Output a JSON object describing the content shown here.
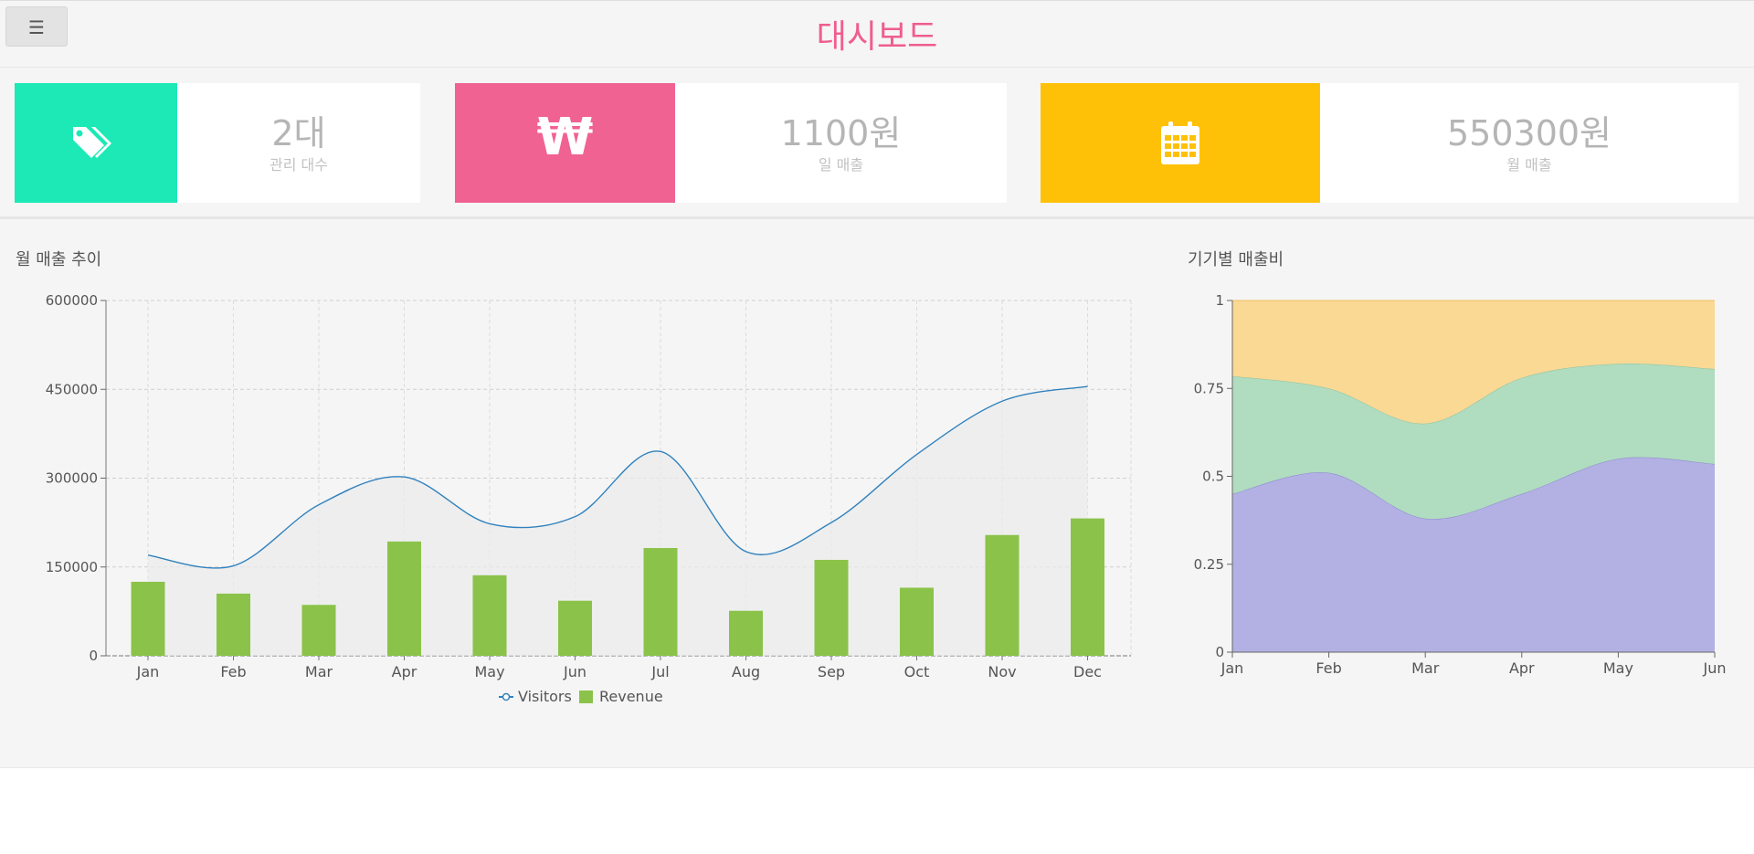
{
  "header": {
    "title": "대시보드",
    "menu_icon": "☰"
  },
  "stats": [
    {
      "icon": "tags-icon",
      "value": "2대",
      "label": "관리 대수",
      "color": "#1de9b6"
    },
    {
      "icon": "won-icon",
      "value": "1100원",
      "label": "일 매출",
      "color": "#f06292",
      "glyph": "₩"
    },
    {
      "icon": "calendar-icon",
      "value": "550300원",
      "label": "월 매출",
      "color": "#ffc107"
    }
  ],
  "charts": {
    "monthly_title": "월 매출 추이",
    "device_title": "기기별 매출비"
  },
  "chart_data": [
    {
      "type": "bar",
      "categories": [
        "Jan",
        "Feb",
        "Mar",
        "Apr",
        "May",
        "Jun",
        "Jul",
        "Aug",
        "Sep",
        "Oct",
        "Nov",
        "Dec"
      ],
      "series": [
        {
          "name": "Visitors",
          "kind": "line",
          "color": "#3182bd",
          "values": [
            170000,
            152000,
            255000,
            302000,
            223000,
            235000,
            345000,
            176000,
            225000,
            340000,
            430000,
            455000
          ]
        },
        {
          "name": "Revenue",
          "kind": "bar",
          "color": "#8bc34a",
          "values": [
            125000,
            105000,
            86000,
            193000,
            136000,
            93000,
            182000,
            76000,
            162000,
            115000,
            204000,
            232000
          ]
        }
      ],
      "yticks": [
        "600000",
        "450000",
        "300000",
        "150000",
        "0"
      ],
      "ylim": [
        0,
        600000
      ],
      "grid": true,
      "legend": "bottom"
    },
    {
      "type": "area",
      "categories": [
        "Jan",
        "Feb",
        "Mar",
        "Apr",
        "May",
        "Jun"
      ],
      "stacked": true,
      "series": [
        {
          "color": "#b3b0e4",
          "line": "#8c88cf",
          "values": [
            0.45,
            0.51,
            0.38,
            0.45,
            0.55,
            0.535
          ]
        },
        {
          "color": "#b0dcc0",
          "line": "#8ec3a0",
          "values": [
            0.335,
            0.24,
            0.27,
            0.33,
            0.27,
            0.27
          ]
        },
        {
          "color": "#fad995",
          "line": "#f0c060",
          "values": [
            0.215,
            0.25,
            0.35,
            0.22,
            0.18,
            0.195
          ]
        }
      ],
      "yticks": [
        "1",
        "0.75",
        "0.5",
        "0.25",
        "0"
      ],
      "ylim": [
        0,
        1
      ],
      "grid": false
    }
  ]
}
